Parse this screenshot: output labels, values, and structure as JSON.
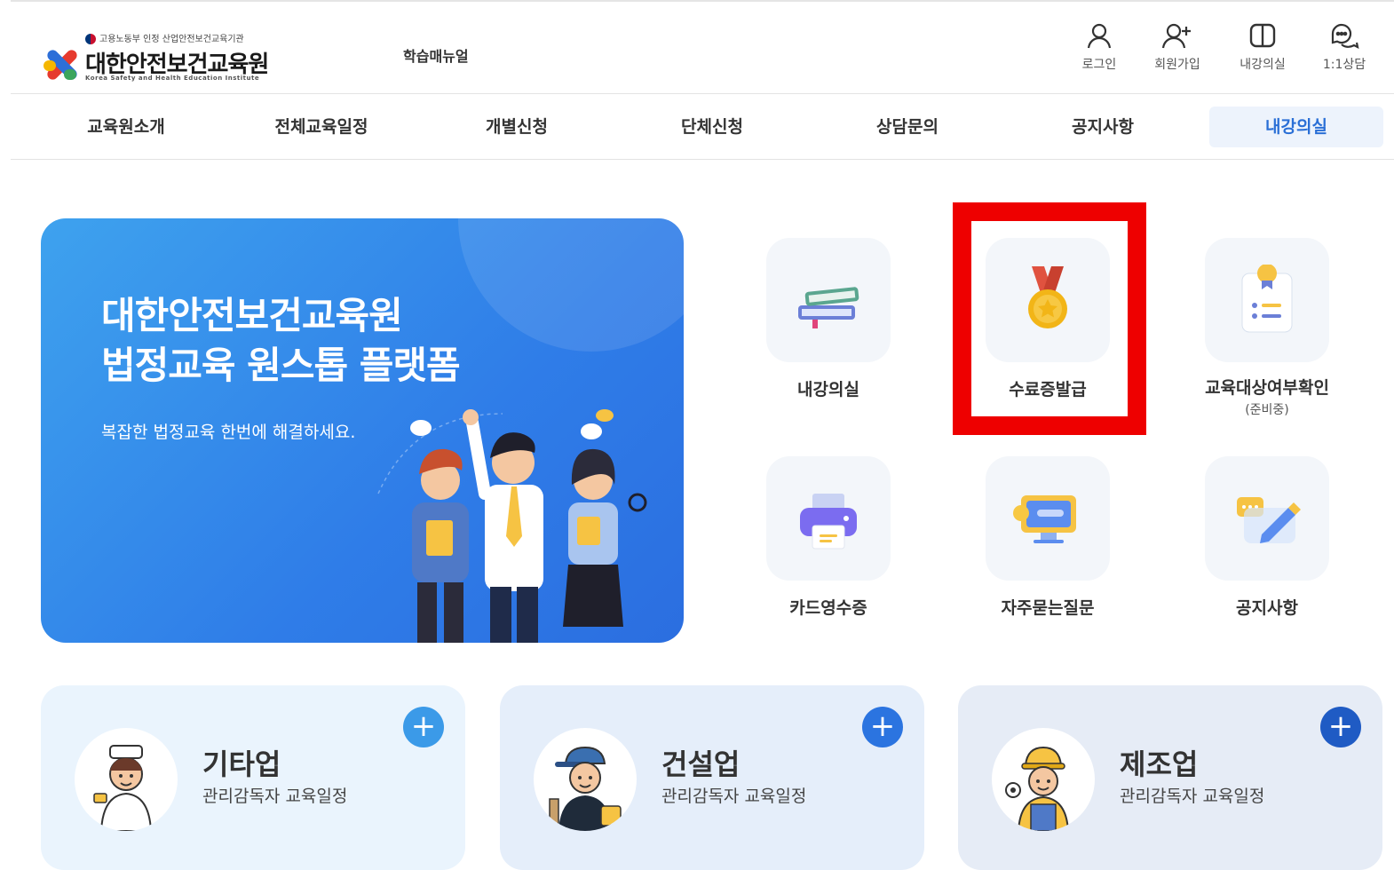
{
  "header": {
    "logo_gov_text": "고용노동부 인정 산업안전보건교육기관",
    "logo_title": "대한안전보건교육원",
    "logo_english": "Korea Safety and Health Education Institute",
    "manual_label": "학습매뉴얼",
    "utils": [
      {
        "label": "로그인",
        "icon": "user-icon"
      },
      {
        "label": "회원가입",
        "icon": "user-plus-icon"
      },
      {
        "label": "내강의실",
        "icon": "book-open-icon"
      },
      {
        "label": "1:1상담",
        "icon": "chat-icon"
      }
    ]
  },
  "nav": {
    "items": [
      {
        "label": "교육원소개"
      },
      {
        "label": "전체교육일정"
      },
      {
        "label": "개별신청"
      },
      {
        "label": "단체신청"
      },
      {
        "label": "상담문의"
      },
      {
        "label": "공지사항"
      },
      {
        "label": "내강의실"
      }
    ],
    "active_index": 6
  },
  "banner": {
    "title_line1": "대한안전보건교육원",
    "title_line2": "법정교육 원스톱 플랫폼",
    "subtitle": "복잡한 법정교육 한번에 해결하세요."
  },
  "quick_menu": [
    {
      "label": "내강의실",
      "icon": "books-icon"
    },
    {
      "label": "수료증발급",
      "icon": "medal-icon"
    },
    {
      "label": "교육대상여부확인",
      "note": "(준비중)",
      "icon": "checklist-icon"
    },
    {
      "label": "카드영수증",
      "icon": "printer-icon"
    },
    {
      "label": "자주묻는질문",
      "icon": "faq-monitor-icon"
    },
    {
      "label": "공지사항",
      "icon": "notice-pencil-icon"
    }
  ],
  "highlight_color": "#ee0000",
  "categories": [
    {
      "title": "기타업",
      "subtitle": "관리감독자 교육일정",
      "plus": "+"
    },
    {
      "title": "건설업",
      "subtitle": "관리감독자 교육일정",
      "plus": "+"
    },
    {
      "title": "제조업",
      "subtitle": "관리감독자 교육일정",
      "plus": "+"
    }
  ],
  "colors": {
    "accent": "#2a6fd6",
    "banner": "#2f7de8"
  }
}
